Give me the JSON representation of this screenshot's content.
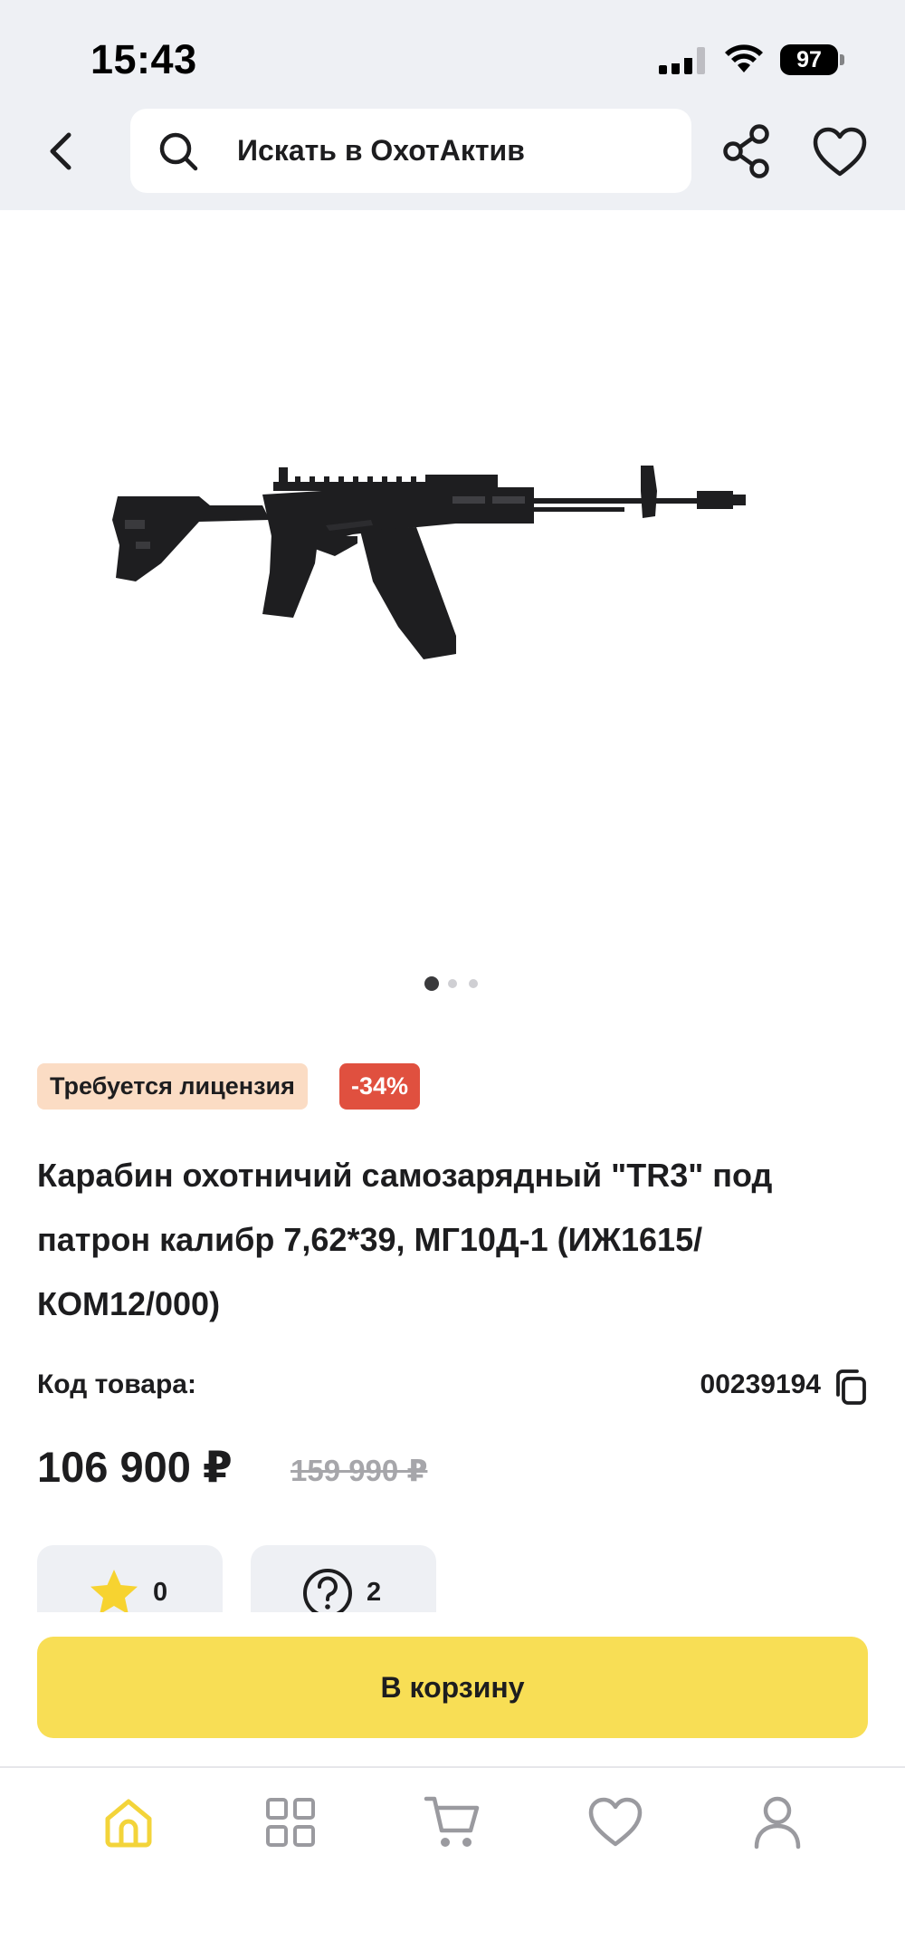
{
  "status_bar": {
    "time": "15:43",
    "battery": "97"
  },
  "header": {
    "search_placeholder": "Искать в ОхотАктив",
    "icons": [
      "back-icon",
      "search-icon",
      "share-icon",
      "heart-icon"
    ]
  },
  "gallery": {
    "image": "rifle-photo",
    "slide_count": 3,
    "active_slide": 1
  },
  "product": {
    "badge_license": "Требуется лицензия",
    "badge_discount": "-34%",
    "title_lines": [
      "Карабин охотничий самозарядный \"TR3\" под",
      "патрон калибр 7,62*39, МГ10Д-1 (ИЖ1615/",
      "КОМ12/000)"
    ],
    "sku_label": "Код товара:",
    "sku_value": "00239194",
    "price_current": "106 900 ₽",
    "price_old": "159 990 ₽",
    "rating_count": "0",
    "questions_count": "2"
  },
  "actions": {
    "cart_label": "В корзину"
  },
  "tab_bar": {
    "tabs": [
      "home-icon",
      "catalog-icon",
      "cart-icon",
      "favorites-icon",
      "profile-icon"
    ],
    "active": "home-icon"
  },
  "colors": {
    "accent_yellow": "#F8DE55",
    "badge_license_bg": "#FBDCC4",
    "badge_discount_bg": "#E0503F",
    "header_bg": "#EEF0F4"
  }
}
